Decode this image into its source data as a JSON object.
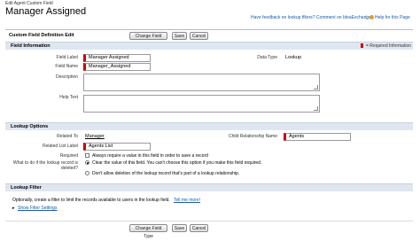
{
  "header": {
    "subtitle": "Edit Agent Custom Field",
    "title": "Manager Assigned",
    "links": {
      "feedback": "Have feedback on lookup filters? Comment on IdeaExchange",
      "help": "Help for this Page",
      "separator": "|"
    }
  },
  "edit_panel": {
    "title": "Custom Field Definition Edit",
    "buttons": {
      "change_field_type": "Change Field Type",
      "save": "Save",
      "cancel": "Cancel"
    },
    "required_note": "= Required Information"
  },
  "field_information": {
    "heading": "Field Information",
    "field_label": {
      "label": "Field Label",
      "value": "Manager Assigned"
    },
    "field_name": {
      "label": "Field Name",
      "value": "Manager_Assigned"
    },
    "description": {
      "label": "Description",
      "value": ""
    },
    "help_text": {
      "label": "Help Text",
      "value": ""
    },
    "data_type": {
      "label": "Data Type",
      "value": "Lookup"
    }
  },
  "lookup_options": {
    "heading": "Lookup Options",
    "related_to": {
      "label": "Related To",
      "value": "Manager"
    },
    "child_relationship": {
      "label": "Child Relationship Name",
      "value": "Agents"
    },
    "related_list_label": {
      "label": "Related List Label",
      "value": "Agents List"
    },
    "required": {
      "label": "Required",
      "option": "Always require a value in this field in order to save a record",
      "checked": false
    },
    "delete_behavior": {
      "label": "What to do if the lookup record is deleted?",
      "options": [
        {
          "text": "Clear the value of this field. You can't choose this option if you make this field required.",
          "selected": true
        },
        {
          "text": "Don't allow deletion of the lookup record that's part of a lookup relationship.",
          "selected": false
        }
      ]
    }
  },
  "lookup_filter": {
    "heading": "Lookup Filter",
    "description": "Optionally, create a filter to limit the records available to users in the lookup field.",
    "tell_me_more": "Tell me more!",
    "show_settings": "Show Filter Settings"
  },
  "colors": {
    "section_bg": "#dfe6ef",
    "link": "#1a5aa8",
    "required": "#cc0000"
  }
}
